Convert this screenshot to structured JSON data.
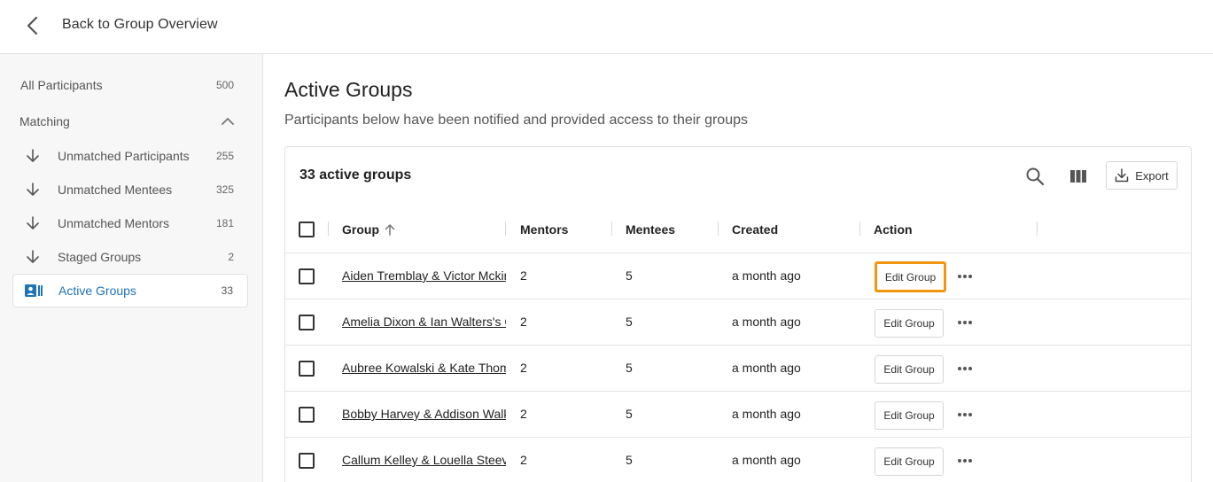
{
  "topbar": {
    "back_label": "Back to Group Overview"
  },
  "sidebar": {
    "all": {
      "label": "All Participants",
      "count": "500"
    },
    "section_label": "Matching",
    "items": [
      {
        "label": "Unmatched Participants",
        "count": "255",
        "icon": "arrow-down-icon"
      },
      {
        "label": "Unmatched Mentees",
        "count": "325",
        "icon": "arrow-down-icon"
      },
      {
        "label": "Unmatched Mentors",
        "count": "181",
        "icon": "arrow-down-icon"
      },
      {
        "label": "Staged Groups",
        "count": "2",
        "icon": "arrow-down-icon"
      },
      {
        "label": "Active Groups",
        "count": "33",
        "icon": "contact-card-icon"
      }
    ]
  },
  "main": {
    "title": "Active Groups",
    "subtitle": "Participants below have been notified and provided access to their groups"
  },
  "table": {
    "count_label": "33 active groups",
    "export_label": "Export",
    "columns": [
      "Group",
      "Mentors",
      "Mentees",
      "Created",
      "Action"
    ],
    "edit_label": "Edit Group",
    "rows": [
      {
        "group": "Aiden Tremblay & Victor Mckinney",
        "mentors": "2",
        "mentees": "5",
        "created": "a month ago"
      },
      {
        "group": "Amelia Dixon & Ian Walters's Group",
        "mentors": "2",
        "mentees": "5",
        "created": "a month ago"
      },
      {
        "group": "Aubree Kowalski & Kate Thompson",
        "mentors": "2",
        "mentees": "5",
        "created": "a month ago"
      },
      {
        "group": "Bobby Harvey & Addison Walker",
        "mentors": "2",
        "mentees": "5",
        "created": "a month ago"
      },
      {
        "group": "Callum Kelley & Louella Steeves",
        "mentors": "2",
        "mentees": "5",
        "created": "a month ago"
      }
    ]
  },
  "colors": {
    "accent": "#1f73b7",
    "highlight": "#f0960f"
  }
}
